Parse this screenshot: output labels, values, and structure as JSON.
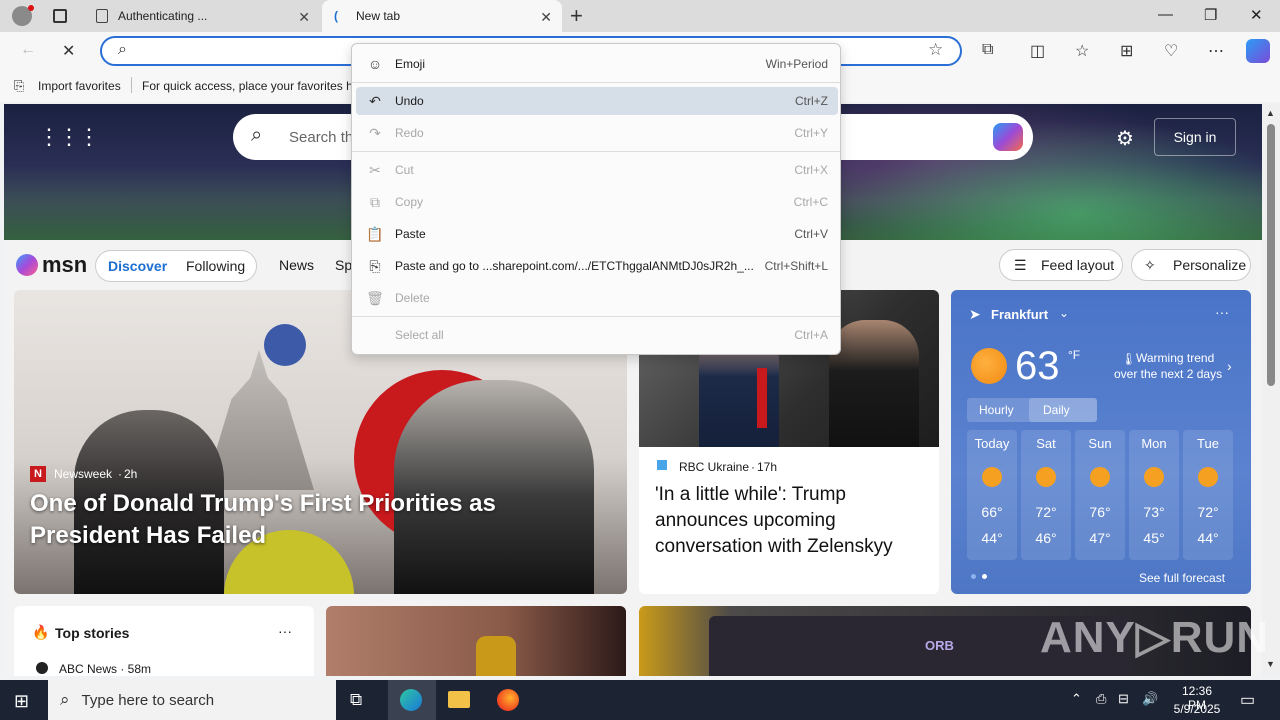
{
  "browser": {
    "tabs": [
      {
        "title": "Authenticating ...",
        "close": "✕"
      },
      {
        "title": "New tab",
        "close": "✕"
      }
    ],
    "new_tab": "+",
    "window_controls": {
      "minimize": "—",
      "restore": "❐",
      "close": "✕"
    },
    "address_value": "",
    "favorites_bar": {
      "import_label": "Import favorites",
      "hint": "For quick access, place your favorites he"
    }
  },
  "msn": {
    "search_placeholder": "Search th",
    "sign_in": "Sign in",
    "logo": "msn",
    "nav": {
      "discover": "Discover",
      "following": "Following",
      "news": "News",
      "sp": "Sp"
    },
    "feed_layout": "Feed layout",
    "personalize": "Personalize"
  },
  "hero_story": {
    "source": "Newsweek",
    "age": "2h",
    "headline": "One of Donald Trump's First Priorities as President Has Failed"
  },
  "story2": {
    "source": "RBC Ukraine",
    "age": "17h",
    "headline": "'In a little while': Trump announces upcoming conversation with Zelenskyy"
  },
  "weather": {
    "location": "Frankfurt",
    "temp": "63",
    "unit": "°F",
    "trend": "Warming trend",
    "trend_sub": "over the next 2 days",
    "tabs": {
      "hourly": "Hourly",
      "daily": "Daily"
    },
    "days": [
      {
        "day": "Today",
        "high": "66°",
        "low": "44°"
      },
      {
        "day": "Sat",
        "high": "72°",
        "low": "46°"
      },
      {
        "day": "Sun",
        "high": "76°",
        "low": "47°"
      },
      {
        "day": "Mon",
        "high": "73°",
        "low": "45°"
      },
      {
        "day": "Tue",
        "high": "72°",
        "low": "44°"
      }
    ],
    "full_forecast": "See full forecast"
  },
  "top_stories": {
    "title": "Top stories",
    "more": "···",
    "first_source": "ABC News · 58m"
  },
  "orb_label": "ORB",
  "context_menu": [
    {
      "label": "Emoji",
      "shortcut": "Win+Period",
      "icon": "☺",
      "disabled": false
    },
    {
      "label": "Undo",
      "shortcut": "Ctrl+Z",
      "icon": "↶",
      "disabled": false
    },
    {
      "label": "Redo",
      "shortcut": "Ctrl+Y",
      "icon": "↷",
      "disabled": true
    },
    {
      "label": "Cut",
      "shortcut": "Ctrl+X",
      "icon": "✂",
      "disabled": true
    },
    {
      "label": "Copy",
      "shortcut": "Ctrl+C",
      "icon": "⧉",
      "disabled": true
    },
    {
      "label": "Paste",
      "shortcut": "Ctrl+V",
      "icon": "📋",
      "disabled": false
    },
    {
      "label": "Paste and go to ...sharepoint.com/.../ETCThggalANMtDJ0sJR2h_...",
      "shortcut": "Ctrl+Shift+L",
      "icon": "⎘",
      "disabled": false
    },
    {
      "label": "Delete",
      "shortcut": "",
      "icon": "🗑",
      "disabled": true
    },
    {
      "label": "Select all",
      "shortcut": "Ctrl+A",
      "icon": "",
      "disabled": true
    }
  ],
  "taskbar": {
    "search_placeholder": "Type here to search",
    "time": "12:36 PM",
    "date": "5/9/2025"
  },
  "watermark": "ANY▷RUN"
}
